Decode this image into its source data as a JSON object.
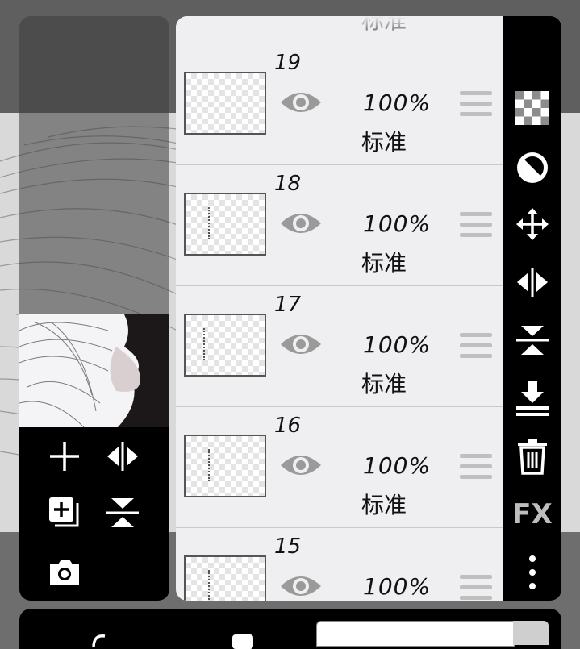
{
  "layers": [
    {
      "number": "19",
      "opacity": "100%",
      "blend": "标准"
    },
    {
      "number": "18",
      "opacity": "100%",
      "blend": "标准"
    },
    {
      "number": "17",
      "opacity": "100%",
      "blend": "标准"
    },
    {
      "number": "16",
      "opacity": "100%",
      "blend": "标准"
    },
    {
      "number": "15",
      "opacity": "100%",
      "blend": ""
    }
  ],
  "partial_top_layer": {
    "blend": "标准"
  },
  "right_toolbar": {
    "items": [
      "transparency-icon",
      "clipping-icon",
      "move-icon",
      "flip-horizontal-icon",
      "flip-vertical-icon",
      "merge-down-icon",
      "trash-icon",
      "fx-icon",
      "more-icon"
    ],
    "fx_label": "FX"
  },
  "left_toolbar": {
    "items": [
      "add-layer-icon",
      "flip-horizontal-icon",
      "add-folder-icon",
      "flip-vertical-icon",
      "camera-icon"
    ]
  },
  "colors": {
    "panel": "#efeff1",
    "toolbar": "#000000",
    "icon": "#ffffff"
  }
}
